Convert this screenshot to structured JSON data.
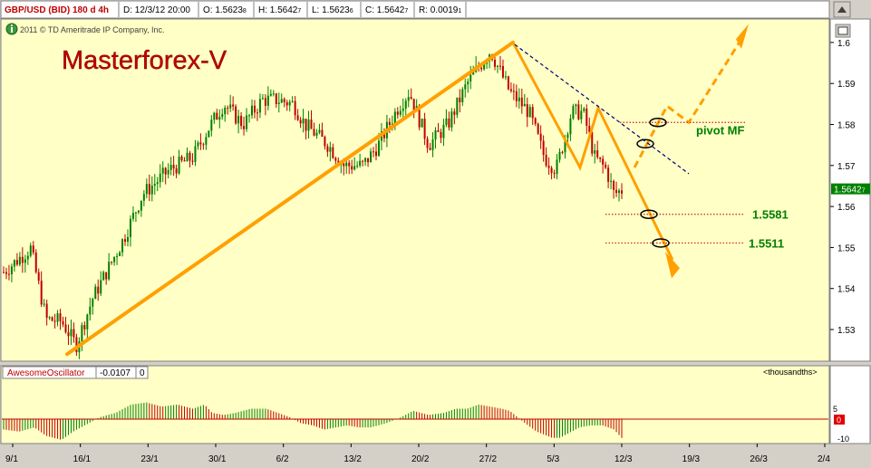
{
  "header": {
    "symbol": "GBP/USD (BID) 180 d 4h",
    "date": "D: 12/3/12 20:00",
    "open": "O: 1.5623",
    "open_sub": "8",
    "high": "H: 1.5642",
    "high_sub": "7",
    "low": "L: 1.5623",
    "low_sub": "6",
    "close": "C: 1.5642",
    "close_sub": "7",
    "range": "R: 0.0019",
    "range_sub": "1",
    "copyright": "2011 © TD Ameritrade IP Company, Inc.",
    "watermark": "Masterforex-V"
  },
  "colors": {
    "plot_bg": "#ffffc6",
    "up": "#008000",
    "down": "#c00000",
    "trend": "#ffa000",
    "dash_line": "#000080",
    "level_dots": "#d02020",
    "level_text": "#008000",
    "title_red": "#c00000"
  },
  "oscillator": {
    "title": "AwesomeOscillator",
    "value": "-0.0107",
    "zero": "0",
    "scale_label": "<thousandths>",
    "right_value": "0",
    "ticks": [
      "5",
      "-10"
    ]
  },
  "chart_data": {
    "type": "candlestick",
    "y_ticks": [
      1.53,
      1.54,
      1.55,
      1.56,
      1.57,
      1.58,
      1.59,
      1.6
    ],
    "y_tick_labels": [
      "1.53",
      "1.54",
      "1.55",
      "1.56",
      "1.57",
      "1.58",
      "1.59",
      "1.6"
    ],
    "ylim": [
      1.5225,
      1.6055
    ],
    "x_tick_labels": [
      "9/1",
      "16/1",
      "23/1",
      "30/1",
      "6/2",
      "13/2",
      "20/2",
      "27/2",
      "5/3",
      "12/3",
      "19/3",
      "26/3",
      "2/4"
    ],
    "current_price_label": "1.5642",
    "current_price_sub": "7",
    "current_price": 1.5643,
    "annotations": [
      {
        "text": "1.5581",
        "price": 1.5581
      },
      {
        "text": "1.5511",
        "price": 1.5511
      },
      {
        "text": "pivot MF",
        "price": 1.5805
      }
    ],
    "trend_main": [
      [
        1.524,
        0
      ],
      [
        1.6,
        1
      ],
      [
        1.57,
        2
      ],
      [
        1.584,
        3
      ],
      [
        1.545,
        4
      ]
    ],
    "trend_projection": [
      [
        1.567,
        0
      ],
      [
        1.584,
        1
      ],
      [
        1.58,
        2
      ],
      [
        1.6045,
        3
      ]
    ],
    "anchors": [
      [
        0.0,
        1.544
      ],
      [
        0.035,
        1.5498
      ],
      [
        0.055,
        1.5325
      ],
      [
        0.075,
        1.532
      ],
      [
        0.094,
        1.5262
      ],
      [
        0.115,
        1.5375
      ],
      [
        0.155,
        1.552
      ],
      [
        0.18,
        1.563
      ],
      [
        0.215,
        1.569
      ],
      [
        0.245,
        1.572
      ],
      [
        0.265,
        1.579
      ],
      [
        0.285,
        1.585
      ],
      [
        0.31,
        1.58
      ],
      [
        0.335,
        1.586
      ],
      [
        0.355,
        1.586
      ],
      [
        0.375,
        1.585
      ],
      [
        0.39,
        1.58
      ],
      [
        0.42,
        1.575
      ],
      [
        0.44,
        1.57
      ],
      [
        0.465,
        1.57
      ],
      [
        0.485,
        1.575
      ],
      [
        0.51,
        1.584
      ],
      [
        0.525,
        1.588
      ],
      [
        0.55,
        1.575
      ],
      [
        0.575,
        1.58
      ],
      [
        0.6,
        1.59
      ],
      [
        0.63,
        1.598
      ],
      [
        0.655,
        1.588
      ],
      [
        0.68,
        1.583
      ],
      [
        0.7,
        1.572
      ],
      [
        0.715,
        1.569
      ],
      [
        0.735,
        1.583
      ],
      [
        0.75,
        1.583
      ],
      [
        0.765,
        1.572
      ],
      [
        0.78,
        1.569
      ],
      [
        0.79,
        1.563
      ],
      [
        0.8,
        1.564
      ]
    ],
    "ao_hist": [
      [
        0.0,
        -5
      ],
      [
        0.02,
        -6
      ],
      [
        0.04,
        -4
      ],
      [
        0.055,
        -8
      ],
      [
        0.075,
        -10
      ],
      [
        0.09,
        -6
      ],
      [
        0.11,
        -2
      ],
      [
        0.125,
        1
      ],
      [
        0.145,
        3
      ],
      [
        0.165,
        7
      ],
      [
        0.185,
        8
      ],
      [
        0.205,
        6
      ],
      [
        0.225,
        7
      ],
      [
        0.245,
        5
      ],
      [
        0.26,
        7
      ],
      [
        0.27,
        3
      ],
      [
        0.285,
        2
      ],
      [
        0.3,
        3
      ],
      [
        0.32,
        5
      ],
      [
        0.34,
        5
      ],
      [
        0.355,
        3
      ],
      [
        0.37,
        1
      ],
      [
        0.385,
        -2
      ],
      [
        0.4,
        -3
      ],
      [
        0.415,
        -5
      ],
      [
        0.43,
        -4
      ],
      [
        0.445,
        -3
      ],
      [
        0.46,
        -4
      ],
      [
        0.475,
        -4
      ],
      [
        0.495,
        -2
      ],
      [
        0.515,
        1
      ],
      [
        0.53,
        4
      ],
      [
        0.55,
        2
      ],
      [
        0.57,
        3
      ],
      [
        0.585,
        5
      ],
      [
        0.6,
        5
      ],
      [
        0.615,
        7
      ],
      [
        0.63,
        6
      ],
      [
        0.645,
        5
      ],
      [
        0.655,
        4
      ],
      [
        0.675,
        -2
      ],
      [
        0.69,
        -6
      ],
      [
        0.71,
        -9
      ],
      [
        0.72,
        -9
      ],
      [
        0.73,
        -7
      ],
      [
        0.745,
        -4
      ],
      [
        0.76,
        -3
      ],
      [
        0.775,
        -3
      ],
      [
        0.79,
        -5
      ],
      [
        0.8,
        -9
      ]
    ]
  }
}
